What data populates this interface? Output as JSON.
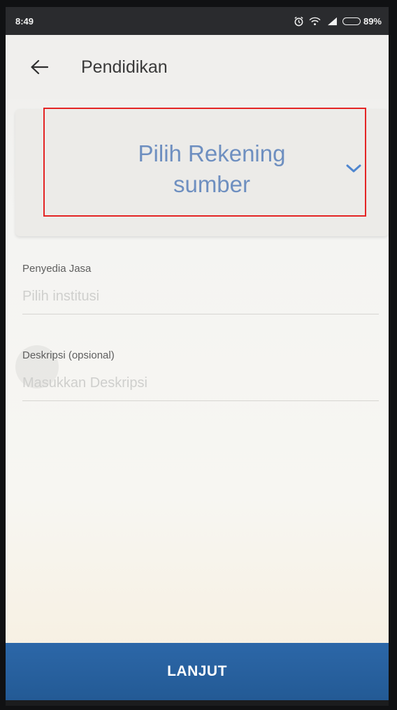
{
  "status_bar": {
    "time": "8:49",
    "battery_percent": "89%",
    "battery_level": 0.89,
    "icons": [
      "alarm-icon",
      "wifi-icon",
      "signal-icon",
      "battery-icon"
    ]
  },
  "app_bar": {
    "title": "Pendidikan",
    "back_icon": "arrow-left-icon"
  },
  "source_account": {
    "label": "Pilih Rekening sumber",
    "icon": "chevron-down-icon",
    "accent_color": "#6e8fc0"
  },
  "fields": {
    "provider": {
      "label": "Penyedia Jasa",
      "placeholder": "Pilih institusi",
      "value": ""
    },
    "description": {
      "label": "Deskripsi (opsional)",
      "placeholder": "Masukkan Deskripsi",
      "value": ""
    }
  },
  "footer": {
    "next_label": "LANJUT",
    "button_color": "#2c67a8"
  },
  "annotation": {
    "highlight_color": "#e42525"
  }
}
